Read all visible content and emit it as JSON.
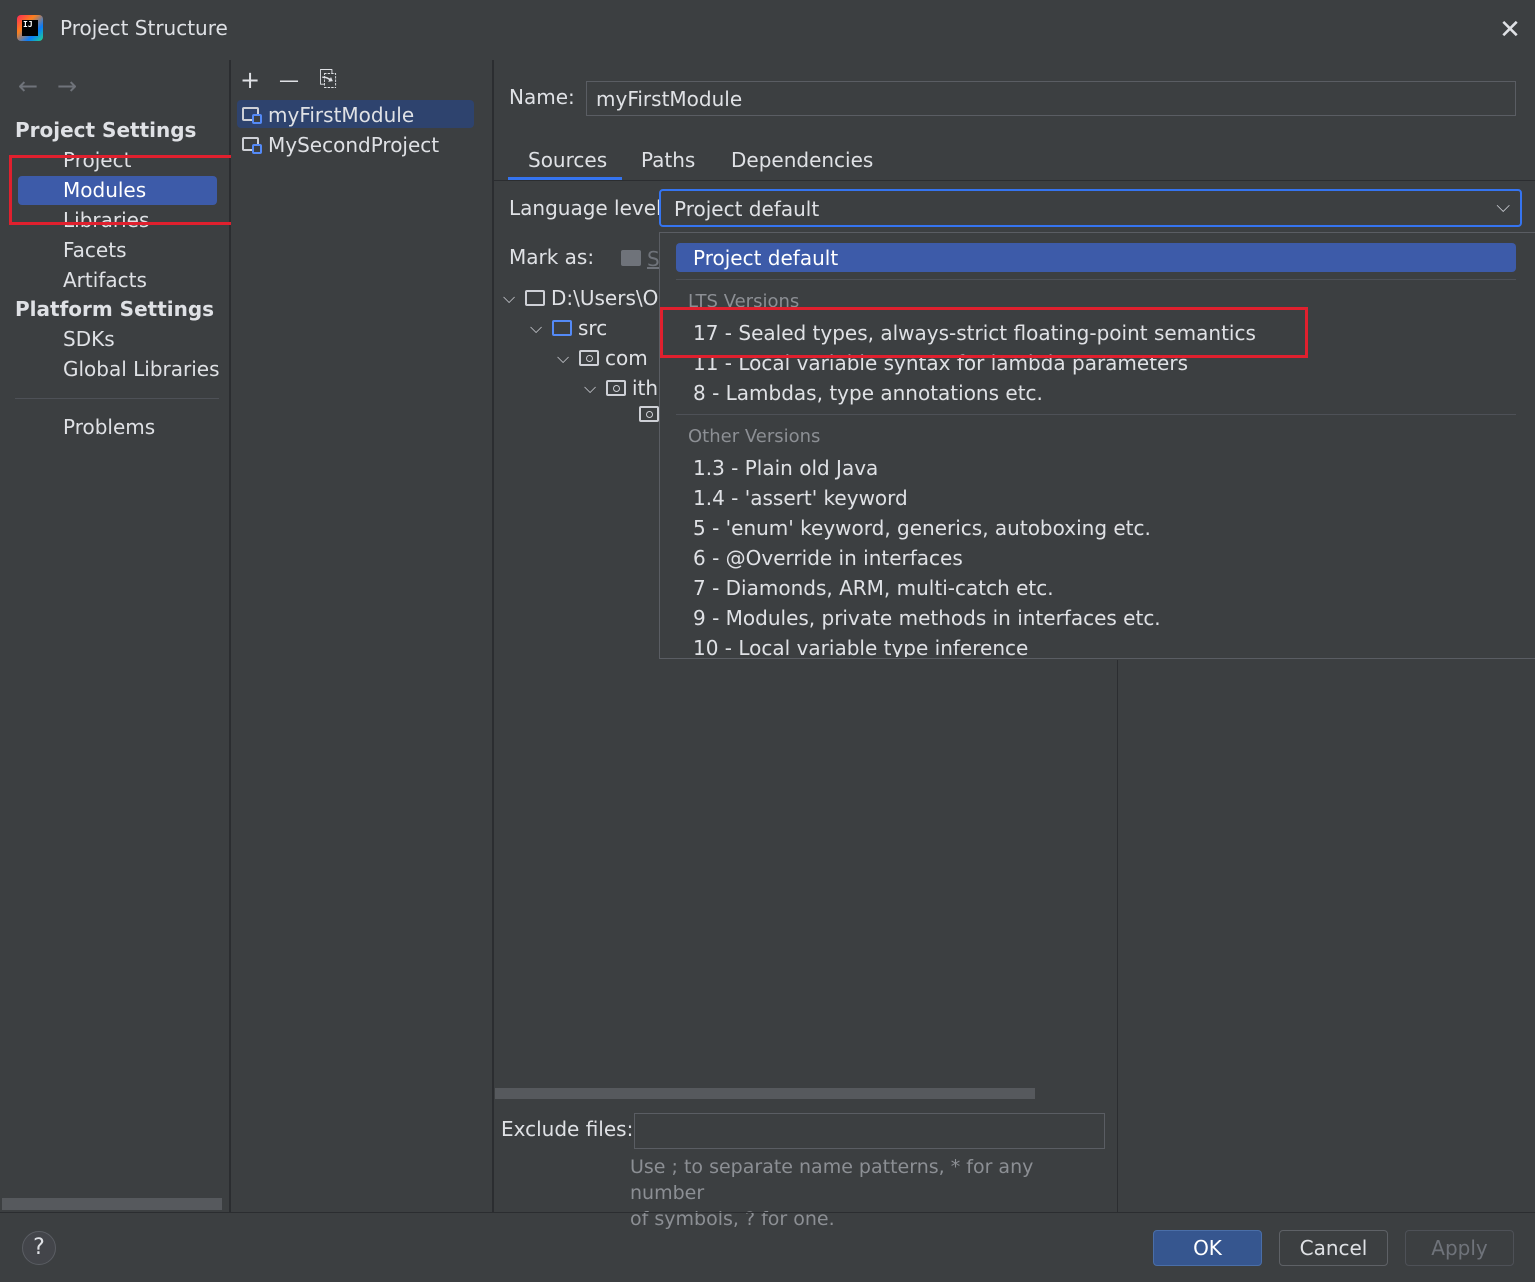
{
  "window": {
    "title": "Project Structure"
  },
  "nav": {
    "back_arrow": "←",
    "forward_arrow": "→",
    "project_settings_heading": "Project Settings",
    "project_settings_items": [
      "Project",
      "Modules",
      "Libraries",
      "Facets",
      "Artifacts"
    ],
    "platform_settings_heading": "Platform Settings",
    "platform_settings_items": [
      "SDKs",
      "Global Libraries"
    ],
    "problems": "Problems",
    "selected": "Modules"
  },
  "modules_toolbar": {
    "add": "+",
    "remove": "—",
    "copy": "⎘"
  },
  "modules": [
    "myFirstModule",
    "MySecondProject"
  ],
  "name_label": "Name:",
  "name_value": "myFirstModule",
  "tabs": [
    "Sources",
    "Paths",
    "Dependencies"
  ],
  "active_tab": "Sources",
  "language_level": {
    "label": "Language level:",
    "value": "Project default",
    "chevron": "⌵"
  },
  "mark_as": {
    "label": "Mark as:",
    "partial": "S"
  },
  "tree": [
    {
      "label": "D:\\Users\\O",
      "icon": "folder-icon"
    },
    {
      "label": "src",
      "icon": "source-folder-icon"
    },
    {
      "label": "com",
      "icon": "package-icon"
    },
    {
      "label": "ith",
      "icon": "package-icon"
    }
  ],
  "exclude": {
    "label": "Exclude files:",
    "value": "",
    "hint_line1": "Use ; to separate name patterns, * for any number",
    "hint_line2": "of symbols, ? for one."
  },
  "dropdown": {
    "selected": "Project default",
    "lts_heading": "LTS Versions",
    "lts_items": [
      "17 - Sealed types, always-strict floating-point semantics",
      "11 - Local variable syntax for lambda parameters",
      "8 - Lambdas, type annotations etc."
    ],
    "other_heading": "Other Versions",
    "other_items": [
      "1.3 - Plain old Java",
      "1.4 - 'assert' keyword",
      "5 - 'enum' keyword, generics, autoboxing etc.",
      "6 - @Override in interfaces",
      "7 - Diamonds, ARM, multi-catch etc.",
      "9 - Modules, private methods in interfaces etc.",
      "10 - Local variable type inference"
    ]
  },
  "buttons": {
    "help": "?",
    "ok": "OK",
    "cancel": "Cancel",
    "apply": "Apply"
  },
  "colors": {
    "background": "#3c3f41",
    "selection": "#3d5ba9",
    "accent": "#3574f0",
    "highlight_box": "#e0202e"
  },
  "close_glyph": "✕"
}
